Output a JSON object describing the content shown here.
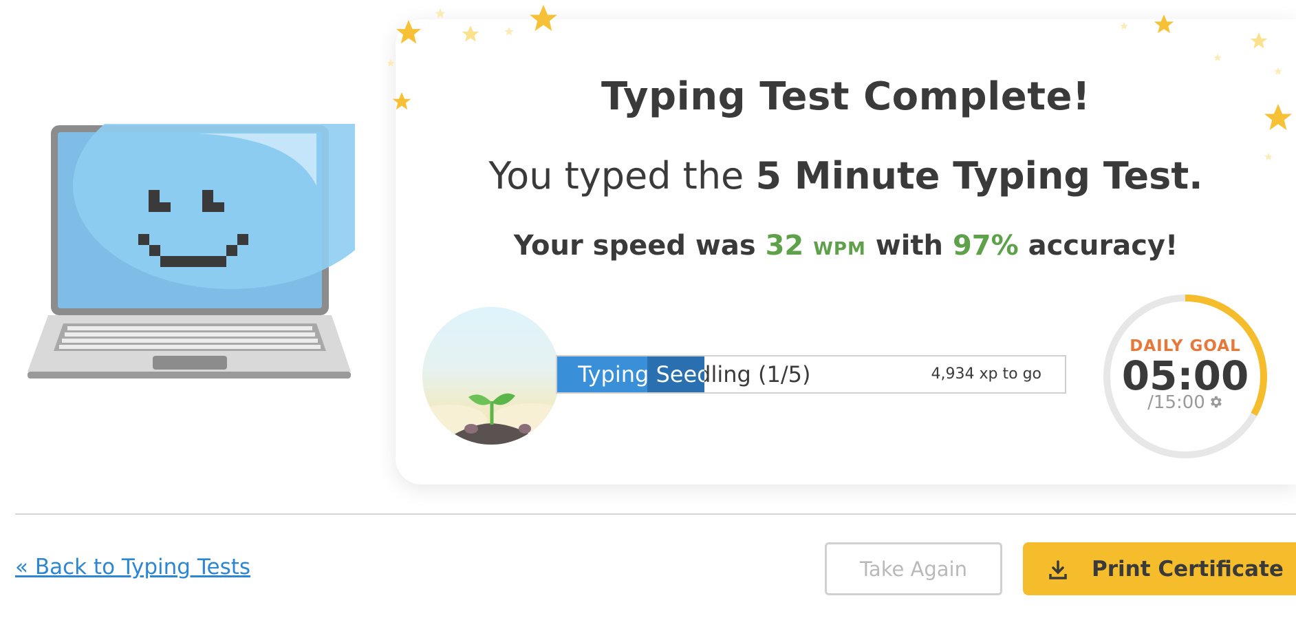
{
  "result": {
    "title": "Typing Test Complete!",
    "subtitle_prefix": "You typed the ",
    "subtitle_test": "5 Minute Typing Test.",
    "speed_prefix": "Your speed was ",
    "speed_value": "32",
    "speed_unit": "WPM",
    "speed_middle": " with ",
    "accuracy_value": "97%",
    "speed_suffix": " accuracy!"
  },
  "level": {
    "label": "Typing Seedling (1/5)",
    "xp_to_go": "4,934 xp to go",
    "progress_fraction": 0.29
  },
  "daily_goal": {
    "label": "DAILY GOAL",
    "time": "05:00",
    "total": "/15:00",
    "progress_fraction": 0.33
  },
  "nav": {
    "back_label": "« Back to Typing Tests",
    "take_again_label": "Take Again",
    "print_label": "Print Certificate"
  },
  "icons": {
    "mascot": "laptop-smiley-icon",
    "plant": "seedling-icon",
    "settings": "gear-icon",
    "download": "download-icon"
  },
  "colors": {
    "accent_green": "#5fa14a",
    "goal_orange": "#e8783a",
    "goal_ring": "#f5bd2c",
    "link_blue": "#2c86d4",
    "print_yellow": "#f5bd2c"
  }
}
